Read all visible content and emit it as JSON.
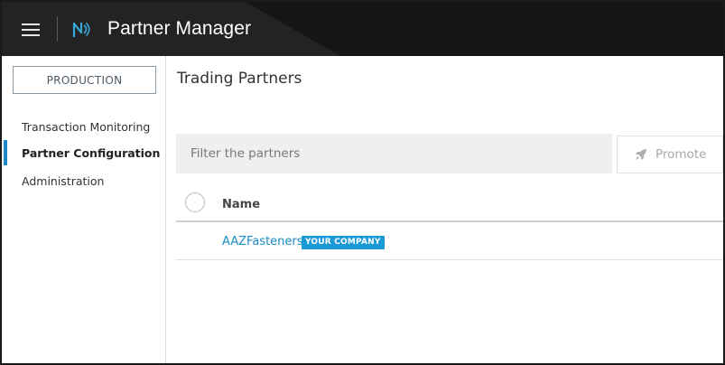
{
  "header": {
    "title": "Partner Manager",
    "menu_icon": "hamburger-icon",
    "logo_icon": "brand-logo-icon"
  },
  "sidebar": {
    "environment": "PRODUCTION",
    "items": [
      {
        "label": "Transaction Monitoring",
        "active": false
      },
      {
        "label": "Partner Configuration",
        "active": true
      },
      {
        "label": "Administration",
        "active": false
      }
    ]
  },
  "main": {
    "title": "Trading Partners",
    "filter": {
      "placeholder": "Filter the partners",
      "value": ""
    },
    "promote_button": {
      "label": "Promote",
      "icon": "rocket-icon",
      "enabled": false
    },
    "table": {
      "columns": [
        "Name"
      ],
      "rows": [
        {
          "name": "AAZFasteners",
          "badge": "YOUR COMPANY"
        }
      ]
    }
  },
  "colors": {
    "header_bg": "#232323",
    "accent": "#1e88c7",
    "link": "#1b8bc6",
    "badge_bg": "#1c9ad6"
  }
}
